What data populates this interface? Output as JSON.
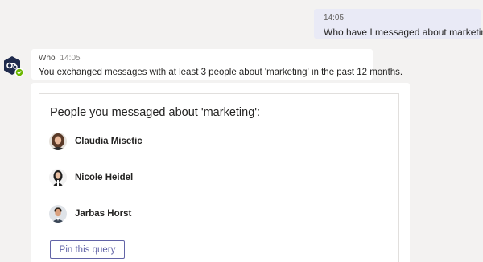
{
  "outgoing": {
    "time": "14:05",
    "text": "Who have I messaged about marketing?"
  },
  "bot": {
    "name": "Who",
    "time": "14:05",
    "message": "You exchanged messages with at least 3 people about 'marketing' in the past 12 months.",
    "avatar_icon": "who-bot-hexagon-icon",
    "status_icon": "online-check-badge",
    "colors": {
      "avatar_bg": "#1f2b4d",
      "status": "#6bb700"
    }
  },
  "card": {
    "title": "People you messaged about 'marketing':",
    "people": [
      {
        "name": "Claudia Misetic",
        "avatar": "avatar-photo-claudia"
      },
      {
        "name": "Nicole Heidel",
        "avatar": "avatar-photo-nicole"
      },
      {
        "name": "Jarbas Horst",
        "avatar": "avatar-photo-jarbas"
      }
    ],
    "pin_button_label": "Pin this query"
  },
  "colors": {
    "background": "#f3f2f1",
    "sent_bubble": "#e9eaf6",
    "accent": "#6264a7"
  }
}
